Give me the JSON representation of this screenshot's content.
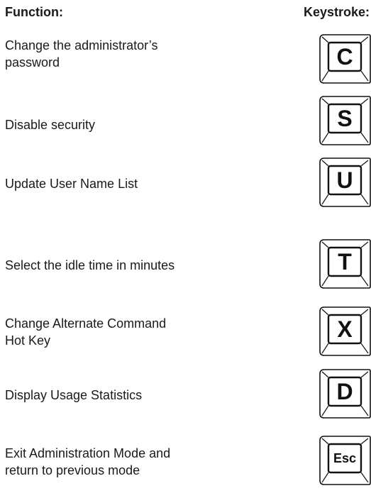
{
  "headers": {
    "function": "Function:",
    "keystroke": "Keystroke:"
  },
  "rows": [
    {
      "function_lines": [
        "Change the administrator’s",
        "password"
      ],
      "key": "C"
    },
    {
      "function_lines": [
        "Disable security"
      ],
      "key": "S"
    },
    {
      "function_lines": [
        "Update User Name List"
      ],
      "key": "U"
    },
    {
      "function_lines": [
        "Select the idle time in minutes"
      ],
      "key": "T"
    },
    {
      "function_lines": [
        "Change Alternate Command",
        "Hot Key"
      ],
      "key": "X"
    },
    {
      "function_lines": [
        "Display Usage Statistics"
      ],
      "key": "D"
    },
    {
      "function_lines": [
        "Exit Administration Mode and",
        "return to previous mode"
      ],
      "key": "Esc"
    }
  ]
}
